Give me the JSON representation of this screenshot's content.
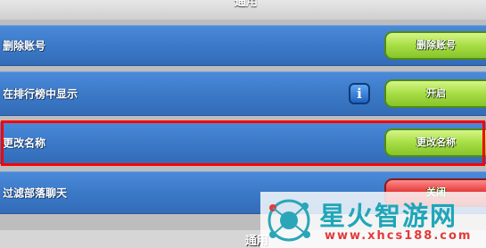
{
  "header": {
    "title_partial": "通用"
  },
  "rows": [
    {
      "label": "删除账号",
      "button": "删除账号",
      "button_color": "#a6de44"
    },
    {
      "label": "在排行榜中显示",
      "button": "开启",
      "button_color": "#a6de44",
      "info_icon": "info-icon"
    },
    {
      "label": "更改名称",
      "button": "更改名称",
      "button_color": "#a6de44"
    },
    {
      "label": "过滤部落聊天",
      "button": "关闭",
      "button_color": "#e23434"
    }
  ],
  "footer": {
    "partial_label": "通用"
  },
  "watermark": {
    "title": "星火智游网",
    "url": "www.xhcs188.com"
  },
  "highlight_color": "#ff0000"
}
